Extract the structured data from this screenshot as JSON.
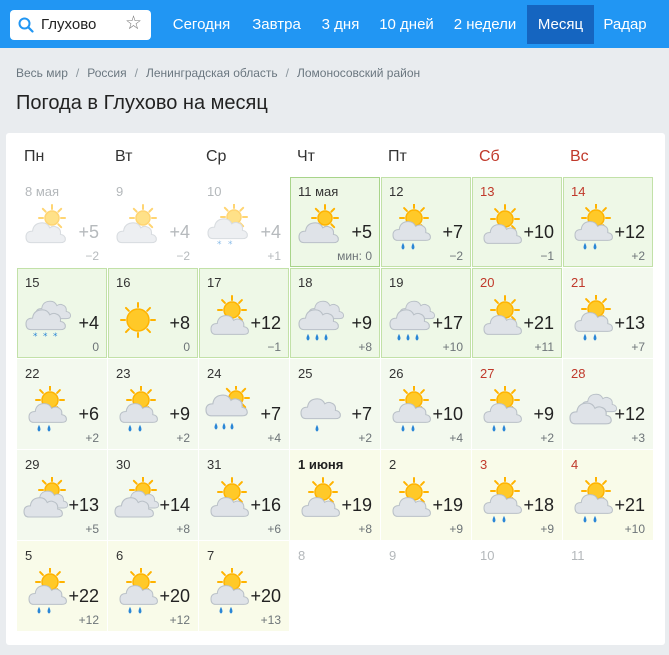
{
  "search": {
    "value": "Глухово"
  },
  "nav": [
    "Сегодня",
    "Завтра",
    "3 дня",
    "10 дней",
    "2 недели",
    "Месяц",
    "Радар"
  ],
  "nav_active": "Месяц",
  "breadcrumb": [
    "Весь мир",
    "Россия",
    "Ленинградская область",
    "Ломоносовский район"
  ],
  "page_title": "Погода в Глухово на месяц",
  "weekdays": [
    "Пн",
    "Вт",
    "Ср",
    "Чт",
    "Пт",
    "Сб",
    "Вс"
  ],
  "weeks": [
    [
      {
        "date": "8 мая",
        "icon": "cloud-sun-icon",
        "max": "+5",
        "min": "−2",
        "state": "past"
      },
      {
        "date": "9",
        "icon": "cloud-sun-icon",
        "max": "+4",
        "min": "−2",
        "state": "past"
      },
      {
        "date": "10",
        "icon": "cloud-sun-snow-icon",
        "max": "+4",
        "min": "+1",
        "state": "past"
      },
      {
        "date": "11 мая",
        "icon": "cloud-sun-icon",
        "max": "+5",
        "min": "мин: 0",
        "state": "today"
      },
      {
        "date": "12",
        "icon": "sun-cloud-rain-icon",
        "max": "+7",
        "min": "−2",
        "state": "g1"
      },
      {
        "date": "13",
        "icon": "sun-cloud-icon",
        "max": "+10",
        "min": "−1",
        "state": "g1",
        "weekend": true
      },
      {
        "date": "14",
        "icon": "sun-cloud-rain-icon",
        "max": "+12",
        "min": "+2",
        "state": "g1",
        "weekend": true
      }
    ],
    [
      {
        "date": "15",
        "icon": "cloud-snow-icon",
        "max": "+4",
        "min": "0",
        "state": "g1"
      },
      {
        "date": "16",
        "icon": "sun-icon",
        "max": "+8",
        "min": "0",
        "state": "g1"
      },
      {
        "date": "17",
        "icon": "sun-cloud-icon",
        "max": "+12",
        "min": "−1",
        "state": "g1"
      },
      {
        "date": "18",
        "icon": "clouds-rain-icon",
        "max": "+9",
        "min": "+8",
        "state": "g1"
      },
      {
        "date": "19",
        "icon": "clouds-rain-icon",
        "max": "+17",
        "min": "+10",
        "state": "g1"
      },
      {
        "date": "20",
        "icon": "sun-cloud-icon",
        "max": "+21",
        "min": "+11",
        "state": "g1",
        "weekend": true
      },
      {
        "date": "21",
        "icon": "sun-cloud-rain-icon",
        "max": "+13",
        "min": "+7",
        "state": "g2",
        "weekend": true
      }
    ],
    [
      {
        "date": "22",
        "icon": "sun-cloud-rain-icon",
        "max": "+6",
        "min": "+2",
        "state": "g2"
      },
      {
        "date": "23",
        "icon": "sun-cloud-rain-icon",
        "max": "+9",
        "min": "+2",
        "state": "g2"
      },
      {
        "date": "24",
        "icon": "cloud-sun-rain-heavy-icon",
        "max": "+7",
        "min": "+4",
        "state": "g2"
      },
      {
        "date": "25",
        "icon": "cloud-rain-icon",
        "max": "+7",
        "min": "+2",
        "state": "g2"
      },
      {
        "date": "26",
        "icon": "sun-cloud-rain-icon",
        "max": "+10",
        "min": "+4",
        "state": "g2"
      },
      {
        "date": "27",
        "icon": "sun-cloud-rain-icon",
        "max": "+9",
        "min": "+2",
        "state": "g2",
        "weekend": true
      },
      {
        "date": "28",
        "icon": "clouds-icon",
        "max": "+12",
        "min": "+3",
        "state": "g2",
        "weekend": true
      }
    ],
    [
      {
        "date": "29",
        "icon": "sun-clouds-icon",
        "max": "+13",
        "min": "+5",
        "state": "g2"
      },
      {
        "date": "30",
        "icon": "sun-clouds-icon",
        "max": "+14",
        "min": "+8",
        "state": "g2"
      },
      {
        "date": "31",
        "icon": "sun-cloud-icon",
        "max": "+16",
        "min": "+6",
        "state": "g2"
      },
      {
        "date": "1 июня",
        "icon": "sun-cloud-icon",
        "max": "+19",
        "min": "+8",
        "state": "g3",
        "bold": true
      },
      {
        "date": "2",
        "icon": "sun-cloud-icon",
        "max": "+19",
        "min": "+9",
        "state": "g3"
      },
      {
        "date": "3",
        "icon": "sun-cloud-rain-icon",
        "max": "+18",
        "min": "+9",
        "state": "g3",
        "weekend": true
      },
      {
        "date": "4",
        "icon": "sun-cloud-rain-icon",
        "max": "+21",
        "min": "+10",
        "state": "g3",
        "weekend": true
      }
    ],
    [
      {
        "date": "5",
        "icon": "sun-cloud-rain-icon",
        "max": "+22",
        "min": "+12",
        "state": "g3"
      },
      {
        "date": "6",
        "icon": "sun-cloud-rain-icon",
        "max": "+20",
        "min": "+12",
        "state": "g3"
      },
      {
        "date": "7",
        "icon": "sun-cloud-rain-icon",
        "max": "+20",
        "min": "+13",
        "state": "g3"
      },
      {
        "date": "8",
        "state": "future"
      },
      {
        "date": "9",
        "state": "future"
      },
      {
        "date": "10",
        "state": "future"
      },
      {
        "date": "11",
        "state": "future"
      }
    ]
  ]
}
